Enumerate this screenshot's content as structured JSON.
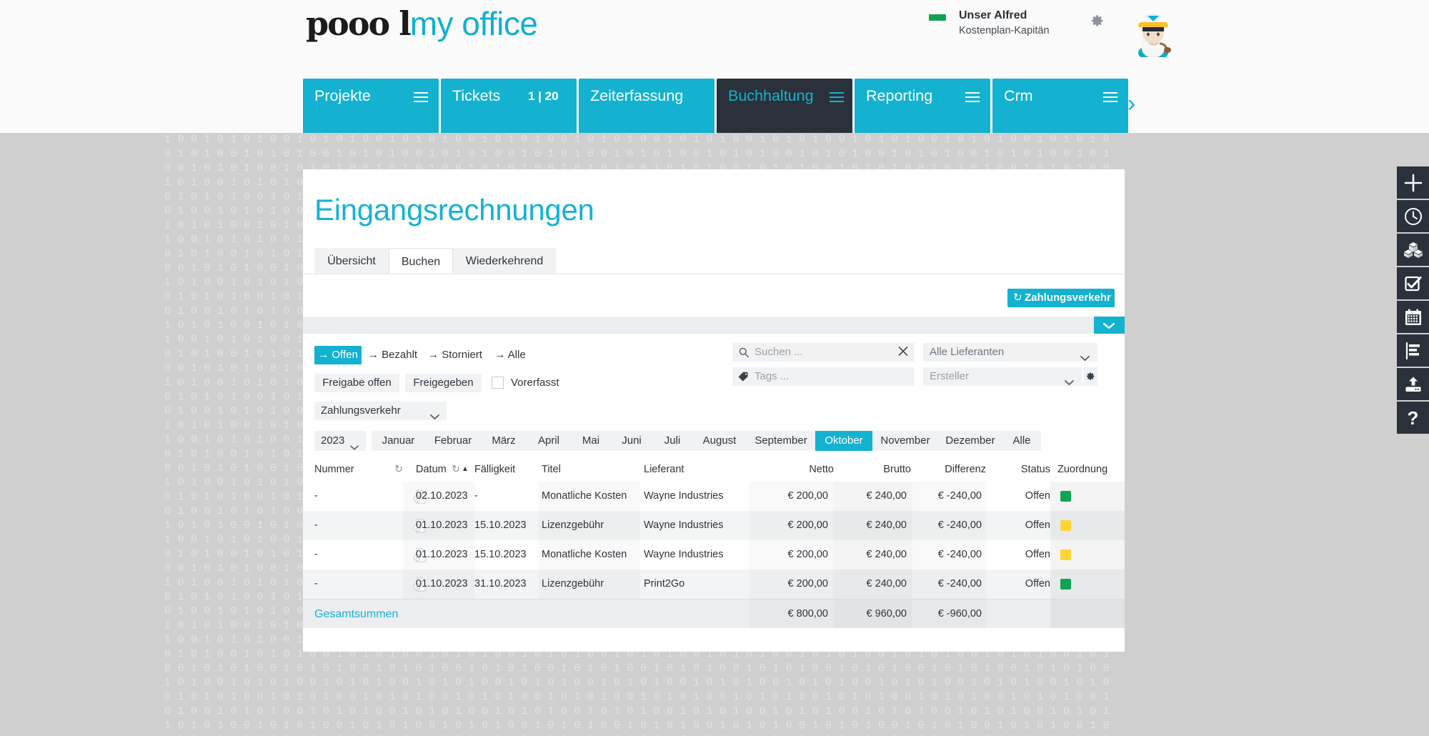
{
  "brand": {
    "dark_word": "pooo l",
    "light_word": "my office",
    "accent": "#14b2d0"
  },
  "user": {
    "name": "Unser Alfred",
    "role": "Kostenplan-Kapitän",
    "status_color": "#12a254",
    "settings_icon": "gear-icon",
    "avatar_icon": "captain-avatar"
  },
  "nav": {
    "items": [
      {
        "label": "Projekte",
        "menu_icon": "hamburger-icon",
        "count": "",
        "active": false
      },
      {
        "label": "Tickets",
        "menu_icon": "",
        "count": "1 | 20",
        "active": false
      },
      {
        "label": "Zeiterfassung",
        "menu_icon": "",
        "count": "",
        "active": false
      },
      {
        "label": "Buchhaltung",
        "menu_icon": "hamburger-icon",
        "count": "",
        "active": true
      },
      {
        "label": "Reporting",
        "menu_icon": "hamburger-icon",
        "count": "",
        "active": false
      },
      {
        "label": "Crm",
        "menu_icon": "hamburger-icon",
        "count": "",
        "active": false
      }
    ],
    "more_icon": "chevron-right-icon"
  },
  "page": {
    "title": "Eingangsrechnungen",
    "subtabs": [
      {
        "label": "Übersicht",
        "active": false
      },
      {
        "label": "Buchen",
        "active": true
      },
      {
        "label": "Wiederkehrend",
        "active": false
      }
    ]
  },
  "actions": {
    "payment_traffic_label": "Zahlungsverkehr",
    "payment_traffic_icon": "refresh-icon",
    "collapse_icon": "chevron-down-icon"
  },
  "filters": {
    "status_pills": [
      {
        "label": "Offen",
        "arrow": "→",
        "active": true
      },
      {
        "label": "Bezahlt",
        "arrow": "→",
        "active": false
      },
      {
        "label": "Storniert",
        "arrow": "→",
        "active": false
      },
      {
        "label": "Alle",
        "arrow": "→",
        "active": false
      }
    ],
    "approval_pills": [
      {
        "label": "Freigabe offen"
      },
      {
        "label": "Freigegeben"
      }
    ],
    "precaptured": {
      "label": "Vorerfasst",
      "checked": false
    },
    "payment_select": {
      "value": "Zahlungsverkehr",
      "caret_icon": "chevron-down-icon"
    },
    "search": {
      "placeholder": "Suchen ...",
      "value": "",
      "icon": "search-icon",
      "clear_icon": "close-icon"
    },
    "tags": {
      "placeholder": "Tags ...",
      "value": "",
      "icon": "tag-icon"
    },
    "supplier": {
      "value": "Alle Lieferanten",
      "caret_icon": "chevron-down-icon"
    },
    "creator": {
      "value": "Ersteller",
      "caret_icon": "chevron-down-icon",
      "settings_icon": "gear-icon"
    }
  },
  "period": {
    "year": "2023",
    "year_caret_icon": "chevron-down-icon",
    "months": [
      {
        "label": "Januar",
        "active": false
      },
      {
        "label": "Februar",
        "active": false
      },
      {
        "label": "März",
        "active": false
      },
      {
        "label": "April",
        "active": false
      },
      {
        "label": "Mai",
        "active": false
      },
      {
        "label": "Juni",
        "active": false
      },
      {
        "label": "Juli",
        "active": false
      },
      {
        "label": "August",
        "active": false
      },
      {
        "label": "September",
        "active": false
      },
      {
        "label": "Oktober",
        "active": true
      },
      {
        "label": "November",
        "active": false
      },
      {
        "label": "Dezember",
        "active": false
      },
      {
        "label": "Alle",
        "active": false
      }
    ]
  },
  "table": {
    "columns": [
      {
        "key": "nummer",
        "label": "Nummer",
        "reset_icon": "reset-icon",
        "sort_icon": ""
      },
      {
        "key": "datum",
        "label": "Datum",
        "reset_icon": "reset-icon",
        "sort_icon": "sort-asc-icon"
      },
      {
        "key": "faellig",
        "label": "Fälligkeit",
        "reset_icon": "",
        "sort_icon": ""
      },
      {
        "key": "titel",
        "label": "Titel",
        "reset_icon": "",
        "sort_icon": ""
      },
      {
        "key": "lieferant",
        "label": "Lieferant",
        "reset_icon": "",
        "sort_icon": ""
      },
      {
        "key": "netto",
        "label": "Netto",
        "reset_icon": "",
        "sort_icon": ""
      },
      {
        "key": "brutto",
        "label": "Brutto",
        "reset_icon": "",
        "sort_icon": ""
      },
      {
        "key": "differenz",
        "label": "Differenz",
        "reset_icon": "",
        "sort_icon": ""
      },
      {
        "key": "status",
        "label": "Status",
        "reset_icon": "",
        "sort_icon": ""
      },
      {
        "key": "zuordnung",
        "label": "Zuordnung",
        "reset_icon": "",
        "sort_icon": ""
      }
    ],
    "rows": [
      {
        "nummer": "-",
        "doc_icon": "invoice-check-icon",
        "datum": "02.10.2023",
        "faellig": "-",
        "titel": "Monatliche Kosten",
        "lieferant": "Wayne Industries",
        "netto": "€ 200,00",
        "brutto": "€ 240,00",
        "differenz": "€ -240,00",
        "status": "Offen",
        "zuordnung_color": "#12a254"
      },
      {
        "nummer": "-",
        "doc_icon": "invoice-check-icon",
        "datum": "01.10.2023",
        "faellig": "15.10.2023",
        "titel": "Lizenzgebühr",
        "lieferant": "Wayne Industries",
        "netto": "€ 200,00",
        "brutto": "€ 240,00",
        "differenz": "€ -240,00",
        "status": "Offen",
        "zuordnung_color": "#fbd633"
      },
      {
        "nummer": "-",
        "doc_icon": "invoice-check-icon",
        "datum": "01.10.2023",
        "faellig": "15.10.2023",
        "titel": "Monatliche Kosten",
        "lieferant": "Wayne Industries",
        "netto": "€ 200,00",
        "brutto": "€ 240,00",
        "differenz": "€ -240,00",
        "status": "Offen",
        "zuordnung_color": "#fbd633"
      },
      {
        "nummer": "-",
        "doc_icon": "invoice-check-icon",
        "datum": "01.10.2023",
        "faellig": "31.10.2023",
        "titel": "Lizenzgebühr",
        "lieferant": "Print2Go",
        "netto": "€ 200,00",
        "brutto": "€ 240,00",
        "differenz": "€ -240,00",
        "status": "Offen",
        "zuordnung_color": "#12a254"
      }
    ],
    "totals": {
      "label": "Gesamtsummen",
      "netto": "€ 800,00",
      "brutto": "€ 960,00",
      "differenz": "€ -960,00"
    }
  },
  "rail": [
    {
      "icon": "plus-icon"
    },
    {
      "icon": "clock-icon"
    },
    {
      "icon": "boxes-icon"
    },
    {
      "icon": "checkbox-icon"
    },
    {
      "icon": "calendar-icon"
    },
    {
      "icon": "list-report-icon"
    },
    {
      "icon": "upload-icon"
    },
    {
      "icon": "help-question-icon"
    }
  ]
}
